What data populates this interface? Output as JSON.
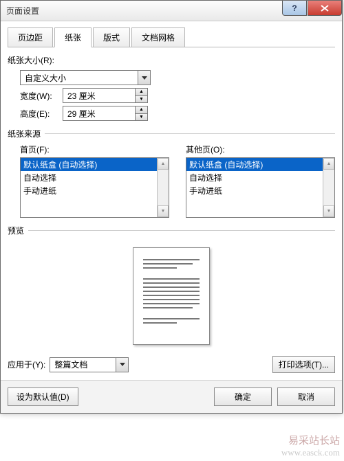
{
  "window": {
    "title": "页面设置"
  },
  "tabs": {
    "margins": "页边距",
    "paper": "纸张",
    "layout": "版式",
    "grid": "文档网格"
  },
  "paper_size": {
    "section_label": "纸张大小(R):",
    "value": "自定义大小",
    "width_label": "宽度(W):",
    "width_value": "23 厘米",
    "height_label": "高度(E):",
    "height_value": "29 厘米"
  },
  "paper_source": {
    "section_label": "纸张来源",
    "first_page_label": "首页(F):",
    "other_pages_label": "其他页(O):",
    "first_items": [
      "默认纸盒 (自动选择)",
      "自动选择",
      "手动进纸"
    ],
    "other_items": [
      "默认纸盒 (自动选择)",
      "自动选择",
      "手动进纸"
    ],
    "first_selected_index": 0,
    "other_selected_index": 0
  },
  "preview": {
    "section_label": "预览"
  },
  "apply_to": {
    "label": "应用于(Y):",
    "value": "整篇文档"
  },
  "buttons": {
    "print_options": "打印选项(T)...",
    "set_default": "设为默认值(D)",
    "ok": "确定",
    "cancel": "取消"
  },
  "watermark": {
    "line1": "易采站长站",
    "line2": "www.easck.com"
  }
}
